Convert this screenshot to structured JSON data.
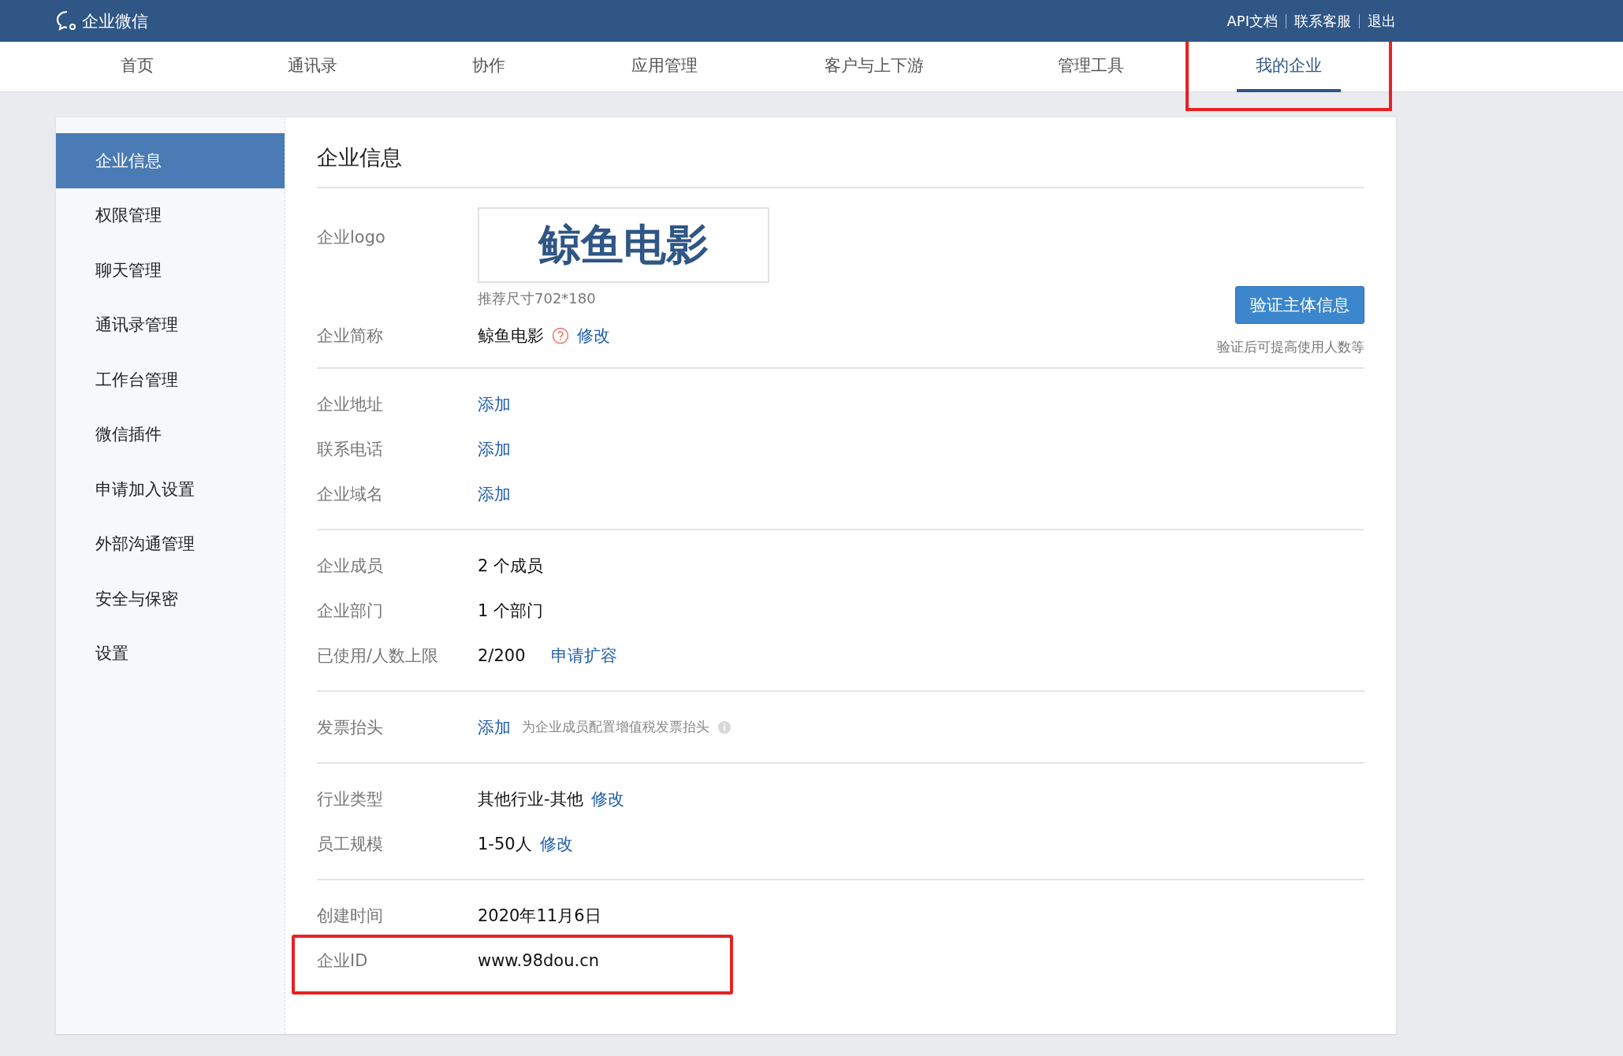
{
  "header": {
    "brand": "企业微信",
    "links": [
      "API文档",
      "联系客服",
      "退出"
    ]
  },
  "nav": [
    {
      "label": "首页",
      "selected": false,
      "highlighted": false
    },
    {
      "label": "通讯录",
      "selected": false,
      "highlighted": false
    },
    {
      "label": "协作",
      "selected": false,
      "highlighted": false
    },
    {
      "label": "应用管理",
      "selected": false,
      "highlighted": false
    },
    {
      "label": "客户与上下游",
      "selected": false,
      "highlighted": false
    },
    {
      "label": "管理工具",
      "selected": false,
      "highlighted": false
    },
    {
      "label": "我的企业",
      "selected": true,
      "highlighted": true
    }
  ],
  "sidebar": {
    "items": [
      {
        "label": "企业信息",
        "selected": true
      },
      {
        "label": "权限管理",
        "selected": false
      },
      {
        "label": "聊天管理",
        "selected": false
      },
      {
        "label": "通讯录管理",
        "selected": false
      },
      {
        "label": "工作台管理",
        "selected": false
      },
      {
        "label": "微信插件",
        "selected": false
      },
      {
        "label": "申请加入设置",
        "selected": false
      },
      {
        "label": "外部沟通管理",
        "selected": false
      },
      {
        "label": "安全与保密",
        "selected": false
      },
      {
        "label": "设置",
        "selected": false
      }
    ]
  },
  "content": {
    "title": "企业信息",
    "verify": {
      "button": "验证主体信息",
      "note": "验证后可提高使用人数等"
    },
    "sections": [
      {
        "rows": [
          {
            "kind": "logo",
            "label": "企业logo",
            "logo_text": "鲸鱼电影",
            "size_hint": "推荐尺寸702*180"
          },
          {
            "kind": "text",
            "label": "企业简称",
            "value": "鲸鱼电影",
            "help": true,
            "action": "修改"
          }
        ]
      },
      {
        "rows": [
          {
            "kind": "text",
            "label": "企业地址",
            "action": "添加"
          },
          {
            "kind": "text",
            "label": "联系电话",
            "action": "添加"
          },
          {
            "kind": "text",
            "label": "企业域名",
            "action": "添加"
          }
        ]
      },
      {
        "rows": [
          {
            "kind": "text",
            "label": "企业成员",
            "value": "2 个成员"
          },
          {
            "kind": "text",
            "label": "企业部门",
            "value": "1 个部门"
          },
          {
            "kind": "text",
            "label": "已使用/人数上限",
            "value": "2/200",
            "action": "申请扩容",
            "wide": true
          }
        ]
      },
      {
        "rows": [
          {
            "kind": "text",
            "label": "发票抬头",
            "action": "添加",
            "note": "为企业成员配置增值税发票抬头",
            "info": true
          }
        ]
      },
      {
        "rows": [
          {
            "kind": "text",
            "label": "行业类型",
            "value": "其他行业-其他",
            "action": "修改"
          },
          {
            "kind": "text",
            "label": "员工规模",
            "value": "1-50人",
            "action": "修改"
          }
        ]
      },
      {
        "rows": [
          {
            "kind": "text",
            "label": "创建时间",
            "value": "2020年11月6日"
          },
          {
            "kind": "text",
            "label": "企业ID",
            "value": "www.98dou.cn",
            "highlighted": true
          }
        ]
      }
    ]
  }
}
